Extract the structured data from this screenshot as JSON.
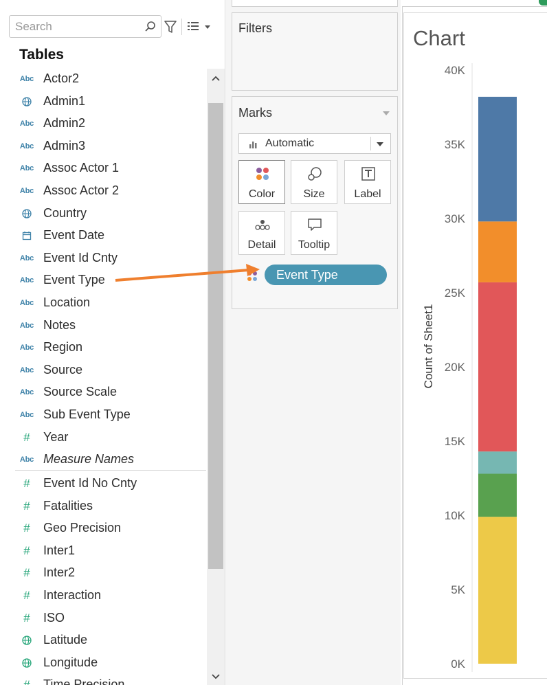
{
  "data_pane": {
    "search": {
      "placeholder": "Search"
    },
    "tables_heading": "Tables",
    "dimensions": [
      {
        "label": "Actor2",
        "icon": "abc",
        "italic": false
      },
      {
        "label": "Admin1",
        "icon": "globe",
        "italic": false
      },
      {
        "label": "Admin2",
        "icon": "abc",
        "italic": false
      },
      {
        "label": "Admin3",
        "icon": "abc",
        "italic": false
      },
      {
        "label": "Assoc Actor 1",
        "icon": "abc",
        "italic": false
      },
      {
        "label": "Assoc Actor 2",
        "icon": "abc",
        "italic": false
      },
      {
        "label": "Country",
        "icon": "globe",
        "italic": false
      },
      {
        "label": "Event Date",
        "icon": "calendar",
        "italic": false
      },
      {
        "label": "Event Id Cnty",
        "icon": "abc",
        "italic": false
      },
      {
        "label": "Event Type",
        "icon": "abc",
        "italic": false
      },
      {
        "label": "Location",
        "icon": "abc",
        "italic": false
      },
      {
        "label": "Notes",
        "icon": "abc",
        "italic": false
      },
      {
        "label": "Region",
        "icon": "abc",
        "italic": false
      },
      {
        "label": "Source",
        "icon": "abc",
        "italic": false
      },
      {
        "label": "Source Scale",
        "icon": "abc",
        "italic": false
      },
      {
        "label": "Sub Event Type",
        "icon": "abc",
        "italic": false
      },
      {
        "label": "Year",
        "icon": "hash",
        "italic": false
      },
      {
        "label": "Measure Names",
        "icon": "abc",
        "italic": true
      }
    ],
    "measures": [
      {
        "label": "Event Id No Cnty",
        "icon": "hash"
      },
      {
        "label": "Fatalities",
        "icon": "hash"
      },
      {
        "label": "Geo Precision",
        "icon": "hash"
      },
      {
        "label": "Inter1",
        "icon": "hash"
      },
      {
        "label": "Inter2",
        "icon": "hash"
      },
      {
        "label": "Interaction",
        "icon": "hash"
      },
      {
        "label": "ISO",
        "icon": "hash"
      },
      {
        "label": "Latitude",
        "icon": "globe"
      },
      {
        "label": "Longitude",
        "icon": "globe"
      },
      {
        "label": "Time Precision",
        "icon": "hash"
      }
    ],
    "icon_text": {
      "abc": "Abc",
      "hash": "#"
    }
  },
  "shelves": {
    "filters_title": "Filters",
    "marks_title": "Marks",
    "mark_type": "Automatic",
    "mark_buttons": [
      {
        "id": "color",
        "label": "Color",
        "icon": "color-dots-icon"
      },
      {
        "id": "size",
        "label": "Size",
        "icon": "size-circles-icon"
      },
      {
        "id": "label",
        "label": "Label",
        "icon": "text-label-icon"
      },
      {
        "id": "detail",
        "label": "Detail",
        "icon": "detail-dots-icon"
      },
      {
        "id": "tooltip",
        "label": "Tooltip",
        "icon": "speech-bubble-icon"
      }
    ],
    "color_pill": "Event Type"
  },
  "colors": {
    "pill": "#4996b2",
    "arrow": "#ef7f2e"
  },
  "chart_data": {
    "type": "bar",
    "title": "Chart",
    "ylabel": "Count of Sheet1",
    "ylim": [
      0,
      40000
    ],
    "ytick_labels": [
      "0K",
      "5K",
      "10K",
      "15K",
      "20K",
      "25K",
      "30K",
      "35K",
      "40K"
    ],
    "yticks": [
      0,
      5000,
      10000,
      15000,
      20000,
      25000,
      30000,
      35000,
      40000
    ],
    "stacked_segments": [
      {
        "value": 9900,
        "color": "#edc948"
      },
      {
        "value": 2900,
        "color": "#59a14f"
      },
      {
        "value": 1500,
        "color": "#76b7b2"
      },
      {
        "value": 11400,
        "color": "#e15759"
      },
      {
        "value": 4100,
        "color": "#f28e2b"
      },
      {
        "value": 8400,
        "color": "#4e79a7"
      }
    ]
  }
}
